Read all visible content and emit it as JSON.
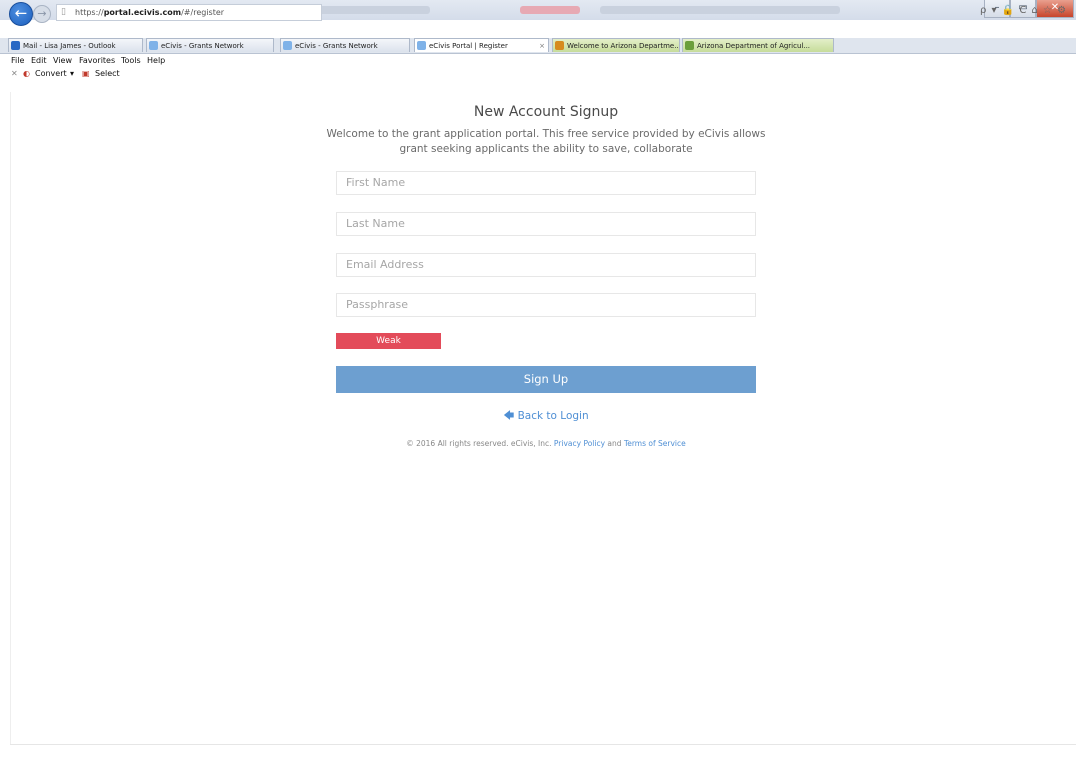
{
  "browser": {
    "url_prefix": "https://",
    "url_host": "portal.ecivis.com",
    "url_path": "/#/register",
    "tabs": [
      {
        "label": "Mail - Lisa James - Outlook"
      },
      {
        "label": "eCivis - Grants Network"
      },
      {
        "label": "eCivis - Grants Network"
      },
      {
        "label": "eCivis Portal | Register"
      },
      {
        "label": "Welcome to Arizona Departme..."
      },
      {
        "label": "Arizona Department of Agricul..."
      }
    ],
    "menu": [
      "File",
      "Edit",
      "View",
      "Favorites",
      "Tools",
      "Help"
    ],
    "commands": {
      "convert": "Convert",
      "select": "Select"
    },
    "tools": "ρ ▾ 🔒 C ⌂ ☆ ⚙"
  },
  "page": {
    "title": "New Account Signup",
    "intro_line1": "Welcome to the grant application portal. This free service provided by eCivis allows",
    "intro_line2": "grant seeking applicants the ability to save, collaborate",
    "fields": {
      "first_name": "First Name",
      "last_name": "Last Name",
      "email": "Email Address",
      "passphrase": "Passphrase"
    },
    "strength": "Weak",
    "signup_button": "Sign Up",
    "back_link": "Back to Login",
    "footer": {
      "prefix": "© 2016 All rights reserved. eCivis, Inc.",
      "privacy": "Privacy Policy",
      "and": "and",
      "terms": "Terms of Service"
    }
  }
}
